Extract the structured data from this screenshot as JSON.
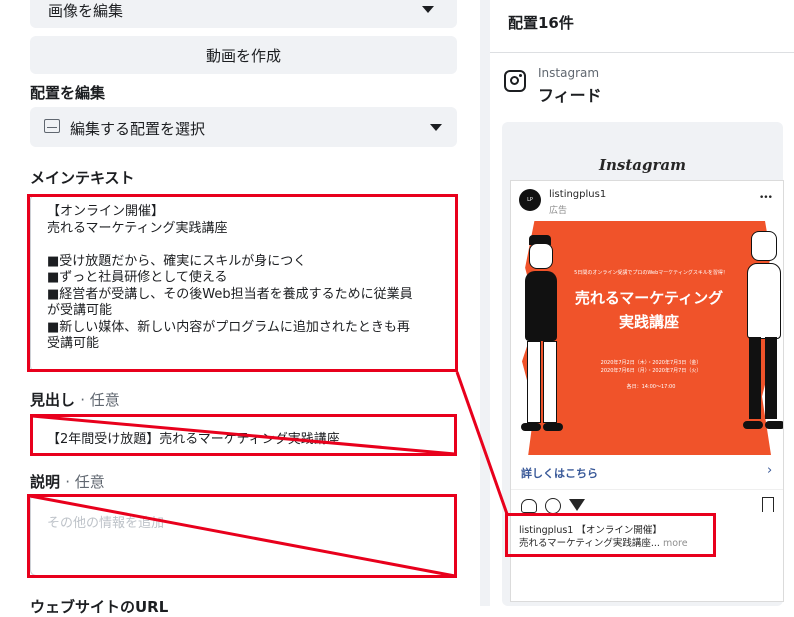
{
  "left": {
    "edit_image_label": "画像を編集",
    "create_video_label": "動画を作成",
    "placement_edit_title": "配置を編集",
    "placement_select_label": "編集する配置を選択",
    "main_text_title": "メインテキスト",
    "main_text_value": "【オンライン開催】\n売れるマーケティング実践講座\n\n■受け放題だから、確実にスキルが身につく\n■ずっと社員研修として使える\n■経営者が受講し、その後Web担当者を養成するために従業員が受講可能\n■新しい媒体、新しい内容がプログラムに追加されたときも再受講可能",
    "headline_title": "見出し",
    "headline_optional": "· 任意",
    "headline_value": "【2年間受け放題】売れるマーケティング実践講座",
    "description_title": "説明",
    "description_optional": "· 任意",
    "description_placeholder": "その他の情報を追加",
    "url_title": "ウェブサイトのURL"
  },
  "right": {
    "placement_count": "配置16件",
    "platform": "Instagram",
    "feed_label": "フィード",
    "ig_logo_text": "Instagram",
    "account_name": "listingplus1",
    "sponsored_label": "広告",
    "more_dots": "•••",
    "creative": {
      "top_line": "5日間のオンライン受講でプロのWebマーケティングスキルを習得！",
      "title_line1": "売れるマーケティング",
      "title_line2": "実践講座",
      "date1": "2020年7月2日（木）・2020年7月3日（金）",
      "date2": "2020年7月6日（月）・2020年7月7日（火）",
      "time": "各日：14:00〜17:00"
    },
    "cta_label": "詳しくはこちら",
    "caption_line1": "listingplus1 【オンライン開催】",
    "caption_line2": "売れるマーケティング実践講座...",
    "caption_more": "more"
  },
  "colors": {
    "accent_red": "#e8001c",
    "cta_blue": "#385898",
    "creative_orange": "#f0532a"
  }
}
